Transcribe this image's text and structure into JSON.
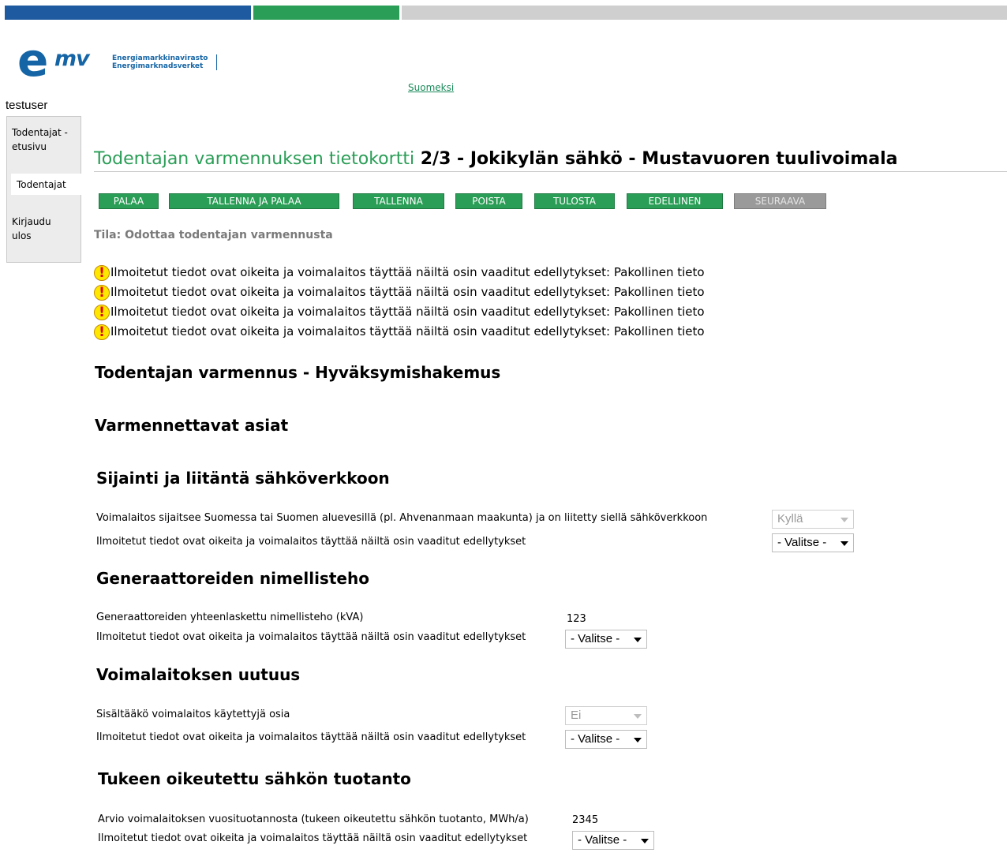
{
  "colors": {
    "brand_blue": "#1565a6",
    "brand_green": "#2a9d56",
    "bar_grey": "#cfcfcf",
    "warning_yellow": "#ffe800"
  },
  "logo": {
    "letters_e": "e",
    "letters_mv": "mv",
    "line1": "Energiamarkkinavirasto",
    "line2": "Energimarknadsverket"
  },
  "language_link": "Suomeksi",
  "user": "testuser",
  "sidebar": {
    "items": [
      {
        "label": "Todentajat - etusivu"
      },
      {
        "label": "Todentajat"
      },
      {
        "label": "Kirjaudu ulos"
      }
    ]
  },
  "title": {
    "prefix": "Todentajan varmennuksen tietokortti",
    "rest": "2/3 - Jokikylän sähkö - Mustavuoren tuulivoimala"
  },
  "toolbar": {
    "palaa": "PALAA",
    "tallenna_ja_palaa": "TALLENNA JA PALAA",
    "tallenna": "TALLENNA",
    "poista": "POISTA",
    "tulosta": "TULOSTA",
    "edellinen": "EDELLINEN",
    "seuraava": "SEURAAVA"
  },
  "status": "Tila: Odottaa todentajan varmennusta",
  "warnings": [
    "Ilmoitetut tiedot ovat oikeita ja voimalaitos täyttää näiltä osin vaaditut edellytykset: Pakollinen tieto",
    "Ilmoitetut tiedot ovat oikeita ja voimalaitos täyttää näiltä osin vaaditut edellytykset: Pakollinen tieto",
    "Ilmoitetut tiedot ovat oikeita ja voimalaitos täyttää näiltä osin vaaditut edellytykset: Pakollinen tieto",
    "Ilmoitetut tiedot ovat oikeita ja voimalaitos täyttää näiltä osin vaaditut edellytykset: Pakollinen tieto"
  ],
  "headings": {
    "main": "Todentajan varmennus - Hyväksymishakemus",
    "items": "Varmennettavat asiat"
  },
  "sections": {
    "location": {
      "heading": "Sijainti ja liitäntä sähköverkkoon",
      "question": "Voimalaitos sijaitsee Suomessa tai Suomen aluevesillä (pl. Ahvenanmaan maakunta) ja on liitetty siellä sähköverkkoon",
      "answer": "Kyllä",
      "confirm_label": "Ilmoitetut tiedot ovat oikeita ja voimalaitos täyttää näiltä osin vaaditut edellytykset",
      "confirm_value": "- Valitse -"
    },
    "generators": {
      "heading": "Generaattoreiden nimellisteho",
      "question": "Generaattoreiden yhteenlaskettu nimellisteho (kVA)",
      "answer": "123",
      "confirm_label": "Ilmoitetut tiedot ovat oikeita ja voimalaitos täyttää näiltä osin vaaditut edellytykset",
      "confirm_value": "- Valitse -"
    },
    "newness": {
      "heading": "Voimalaitoksen uutuus",
      "question": "Sisältääkö voimalaitos käytettyjä osia",
      "answer": "Ei",
      "confirm_label": "Ilmoitetut tiedot ovat oikeita ja voimalaitos täyttää näiltä osin vaaditut edellytykset",
      "confirm_value": "- Valitse -"
    },
    "production": {
      "heading": "Tukeen oikeutettu sähkön tuotanto",
      "question": "Arvio voimalaitoksen vuosituotannosta (tukeen oikeutettu sähkön tuotanto, MWh/a)",
      "answer": "2345",
      "confirm_label": "Ilmoitetut tiedot ovat oikeita ja voimalaitos täyttää näiltä osin vaaditut edellytykset",
      "confirm_value": "- Valitse -"
    }
  }
}
